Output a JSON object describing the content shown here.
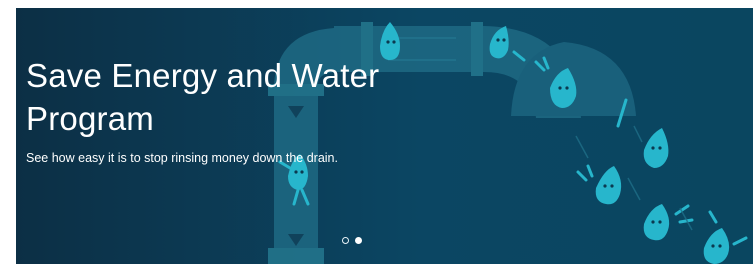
{
  "hero": {
    "title": "Save Energy and Water Program",
    "subtitle": "See how easy it is to stop rinsing money down the drain."
  },
  "carousel": {
    "slides": 2,
    "active_index": 1
  },
  "colors": {
    "background_dark": "#0c2f45",
    "pipe": "#1e6d86",
    "droplet": "#27b6cc",
    "text": "#ffffff"
  },
  "illustration": {
    "icons": [
      "water-pipe-icon",
      "water-droplet-character-icon"
    ]
  }
}
